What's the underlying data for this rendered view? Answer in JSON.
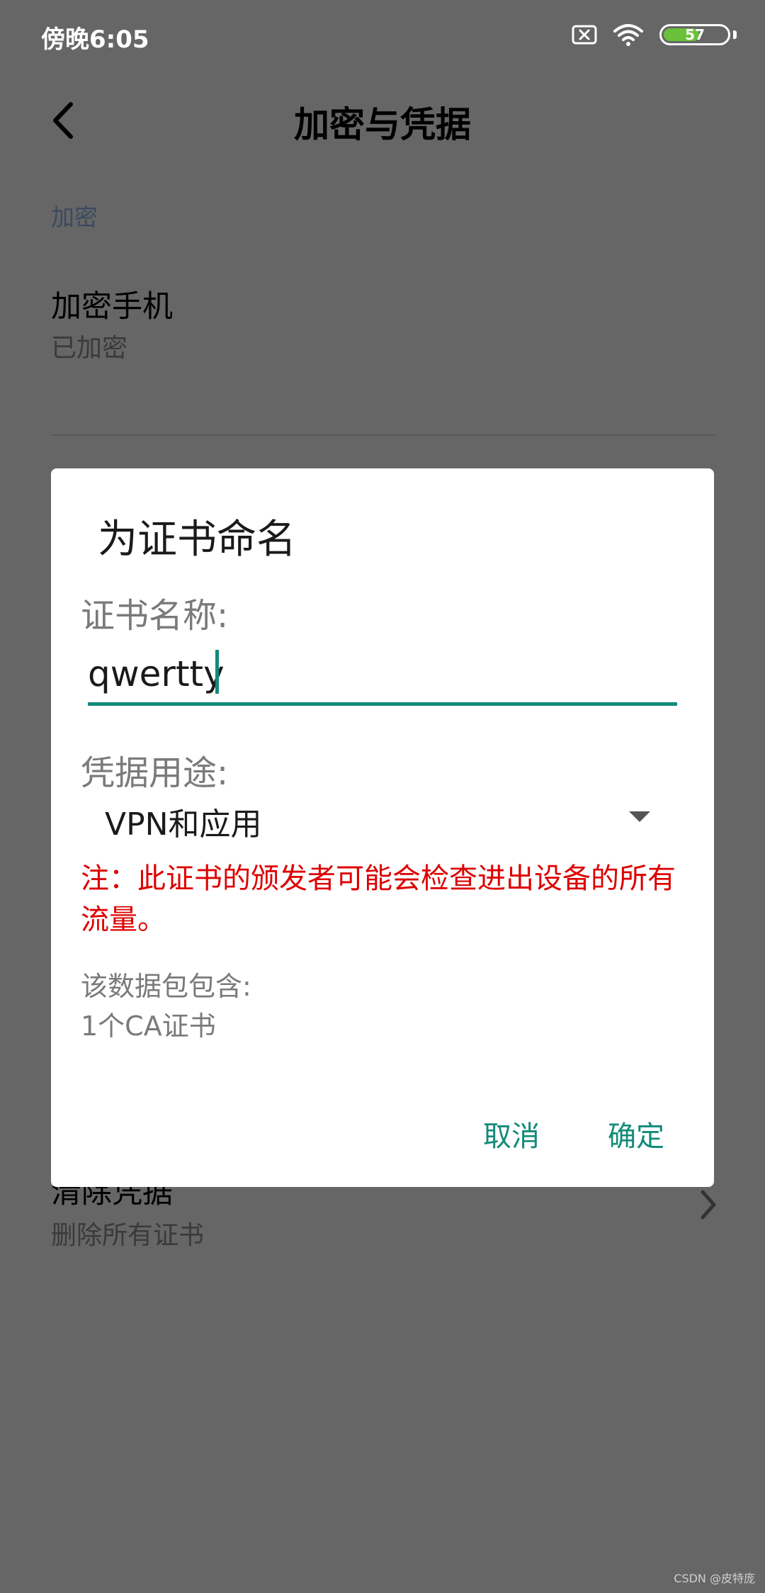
{
  "status_bar": {
    "time": "傍晚6:05",
    "battery_level": "57",
    "battery_fraction": 0.57,
    "battery_color": "#6ac03a",
    "icons": [
      "sim-off-icon",
      "wifi-icon",
      "battery-icon"
    ]
  },
  "header": {
    "title": "加密与凭据",
    "back_icon": "chevron-left-icon"
  },
  "settings": {
    "section_label": "加密",
    "encrypt_phone": {
      "title": "加密手机",
      "subtitle": "已加密"
    },
    "clear_credentials": {
      "title": "清除凭据",
      "subtitle": "删除所有证书",
      "icon": "chevron-right-icon"
    }
  },
  "dialog": {
    "title": "为证书命名",
    "name_label": "证书名称:",
    "name_value": "qwertty",
    "usage_label": "凭据用途:",
    "usage_value": "VPN和应用",
    "warning": "注：此证书的颁发者可能会检查进出设备的所有流量。",
    "contains_label": "该数据包包含:",
    "contains_value": "1个CA证书",
    "cancel_label": "取消",
    "ok_label": "确定",
    "accent_color": "#128a7a",
    "warning_color": "#dd0000"
  },
  "watermark": "CSDN @皮特庞"
}
